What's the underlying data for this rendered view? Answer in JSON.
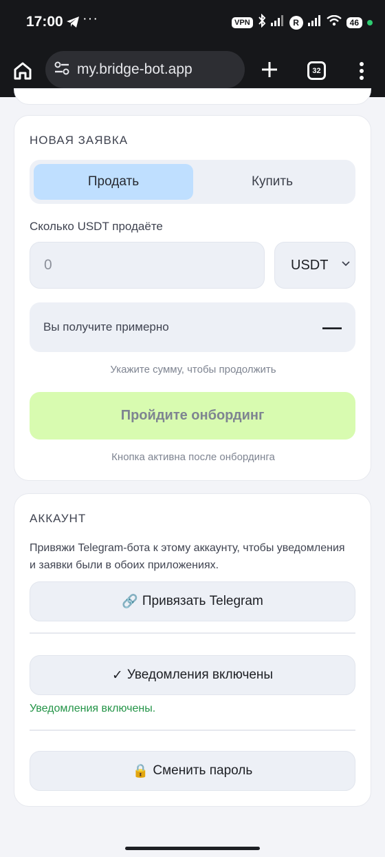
{
  "status_bar": {
    "time": "17:00",
    "overflow": "···",
    "vpn": "VPN",
    "carrier_badge": "R",
    "battery": "46"
  },
  "browser": {
    "url": "my.bridge-bot.app",
    "tab_count": "32"
  },
  "order": {
    "title": "НОВАЯ ЗАЯВКА",
    "tabs": [
      {
        "label": "Продать",
        "active": true
      },
      {
        "label": "Купить",
        "active": false
      }
    ],
    "amount_label": "Сколько USDT продаёте",
    "amount_placeholder": "0",
    "currency": "USDT",
    "estimate_label": "Вы получите примерно",
    "estimate_value": "—",
    "hint": "Укажите сумму, чтобы продолжить",
    "cta_label": "Пройдите онбординг",
    "cta_note": "Кнопка активна после онбординга"
  },
  "account": {
    "title": "АККАУНТ",
    "description": "Привяжи Telegram-бота к этому аккаунту, чтобы уведомления и заявки были в обоих приложениях.",
    "link_telegram_label": "Привязать Telegram",
    "link_icon": "🔗",
    "notifications_label": "Уведомления включены",
    "notifications_icon": "✓",
    "notifications_status": "Уведомления включены.",
    "change_password_label": "Сменить пароль",
    "password_icon": "🔒"
  },
  "colors": {
    "accent_sell": "#bfdfff",
    "cta_disabled": "#d8fbb0",
    "success_text": "#239447"
  }
}
